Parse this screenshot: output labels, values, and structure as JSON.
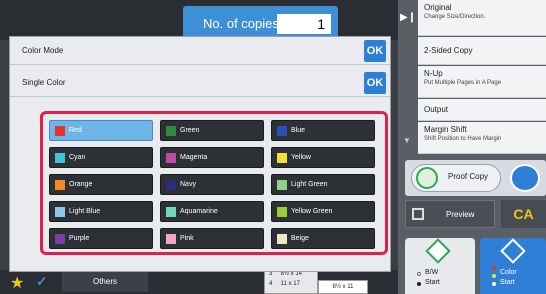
{
  "top": {
    "copies_label": "No. of copies",
    "copies_value": "1"
  },
  "right_panel": {
    "items": [
      {
        "title": "Original",
        "sub": "Change Size/Direction."
      },
      {
        "title": "2-Sided Copy",
        "sub": ""
      },
      {
        "title": "N-Up",
        "sub": "Put Multiple Pages in A Page"
      },
      {
        "title": "Output",
        "sub": ""
      },
      {
        "title": "Margin Shift",
        "sub": "Shift Position to Have Margin"
      }
    ],
    "proof_copy": "Proof Copy",
    "preview": "Preview",
    "ca": "CA",
    "start_bw": {
      "mode": "B/W",
      "label": "Start"
    },
    "start_color": {
      "mode": "Color",
      "label": "Start"
    }
  },
  "bottom": {
    "others": "Others",
    "tray_rows": [
      {
        "n": "3",
        "size": "8½ x 14"
      },
      {
        "n": "4",
        "size": "11 x 17"
      }
    ],
    "tray_extra": "8½ x 11"
  },
  "dialog": {
    "color_mode_label": "Color Mode",
    "single_color_label": "Single Color",
    "ok": "OK",
    "selected": "Red",
    "colors": [
      {
        "name": "Red",
        "swatch": "#e0342c"
      },
      {
        "name": "Green",
        "swatch": "#2e8b3a"
      },
      {
        "name": "Blue",
        "swatch": "#2a4fb5"
      },
      {
        "name": "Cyan",
        "swatch": "#3bc6d6"
      },
      {
        "name": "Magenta",
        "swatch": "#c04aa8"
      },
      {
        "name": "Yellow",
        "swatch": "#f2e030"
      },
      {
        "name": "Orange",
        "swatch": "#f08a22"
      },
      {
        "name": "Navy",
        "swatch": "#2a2f7a"
      },
      {
        "name": "Light Green",
        "swatch": "#8fd08a"
      },
      {
        "name": "Light Blue",
        "swatch": "#8cc8ee"
      },
      {
        "name": "Aquamarine",
        "swatch": "#6fd6c0"
      },
      {
        "name": "Yellow Green",
        "swatch": "#9ccd2e"
      },
      {
        "name": "Purple",
        "swatch": "#7b3fa0"
      },
      {
        "name": "Pink",
        "swatch": "#f2a7c6"
      },
      {
        "name": "Beige",
        "swatch": "#efe6c8"
      }
    ]
  }
}
